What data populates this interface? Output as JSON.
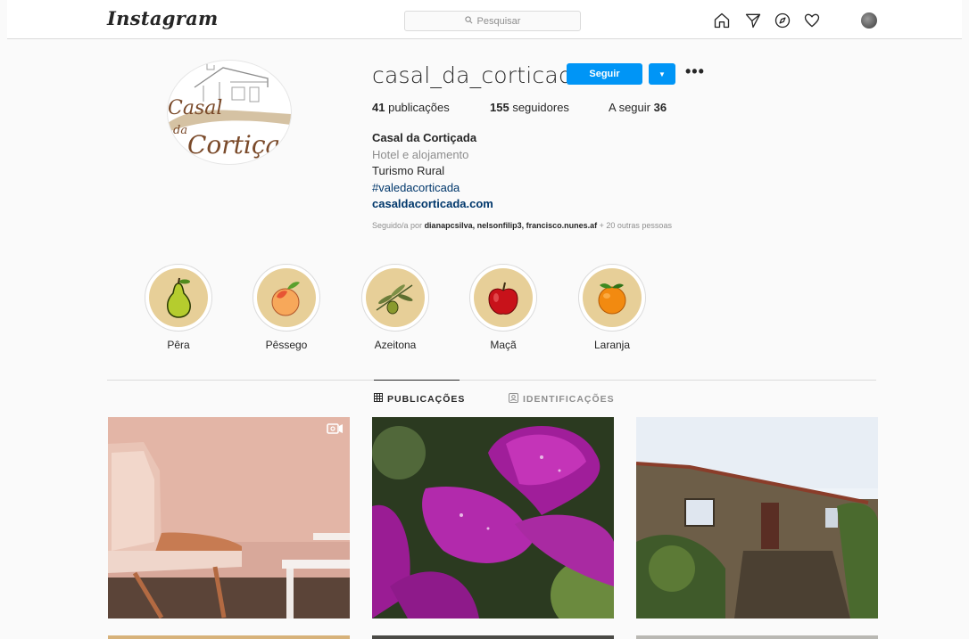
{
  "topbar": {
    "logo": "Instagram",
    "search_placeholder": "Pesquisar",
    "nav_icons": [
      "home-icon",
      "direct-icon",
      "explore-icon",
      "activity-heart-icon",
      "profile-avatar"
    ]
  },
  "profile": {
    "username": "casal_da_corticada",
    "follow_label": "Seguir",
    "stats": {
      "posts_count": "41",
      "posts_label": "publicações",
      "followers_count": "155",
      "followers_label": "seguidores",
      "following_label": "A seguir",
      "following_count": "36"
    },
    "bio": {
      "name": "Casal da Cortiçada",
      "category": "Hotel e alojamento",
      "line": "Turismo Rural",
      "hashtag": "#valedacorticada",
      "website": "casaldacorticada.com"
    },
    "followed_by": {
      "prefix": "Seguido/a por",
      "names": "dianapcsilva, nelsonfilip3, francisco.nunes.af",
      "suffix": "+ 20 outras pessoas"
    },
    "avatar_text_1": "Casal",
    "avatar_text_2": "da",
    "avatar_text_3": "Cortiçada"
  },
  "highlights": [
    {
      "label": "Pêra",
      "icon": "pear-icon"
    },
    {
      "label": "Pêssego",
      "icon": "peach-icon"
    },
    {
      "label": "Azeitona",
      "icon": "olive-icon"
    },
    {
      "label": "Maçã",
      "icon": "apple-icon"
    },
    {
      "label": "Laranja",
      "icon": "orange-icon"
    }
  ],
  "tabs": [
    {
      "label": "PUBLICAÇÕES",
      "icon": "grid-icon",
      "active": true
    },
    {
      "label": "IDENTIFICAÇÕES",
      "icon": "tagged-icon",
      "active": false
    }
  ],
  "colors": {
    "accent": "#0095f6",
    "link": "#00376b",
    "highlight_bg": "#e7cf98"
  }
}
